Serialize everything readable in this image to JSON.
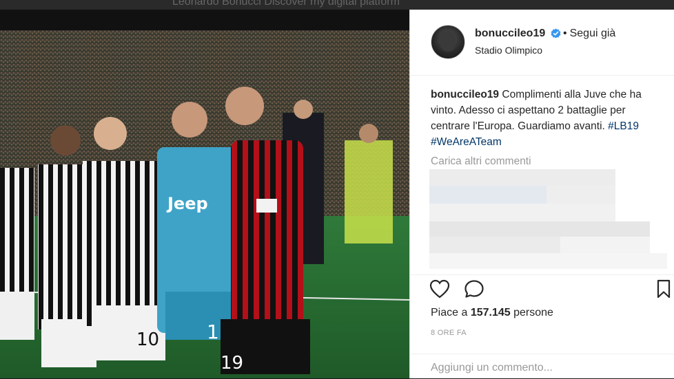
{
  "background": {
    "overlay_text": "Leonardo Bonucci Discover my digital platform"
  },
  "post": {
    "username": "bonuccileo19",
    "follow_label": "Segui già",
    "location": "Stadio Olimpico",
    "caption_user": "bonuccileo19",
    "caption_text": "Complimenti alla Juve che ha vinto. Adesso ci aspettano 2 battaglie per centrare l'Europa. Guardiamo avanti.",
    "hashtags": [
      "#LB19",
      "#WeAreATeam"
    ],
    "load_more": "Carica altri commenti",
    "likes_prefix": "Piace a",
    "likes_count": "157.145",
    "likes_suffix": "persone",
    "time_ago": "8 ORE FA",
    "add_comment_placeholder": "Aggiungi un commento..."
  },
  "icons": [
    "heart-icon",
    "comment-icon",
    "bookmark-icon",
    "verified-badge-icon"
  ],
  "colors": {
    "hashtag": "#003569",
    "verified": "#3897f0",
    "text": "#262626",
    "muted": "#999999"
  }
}
